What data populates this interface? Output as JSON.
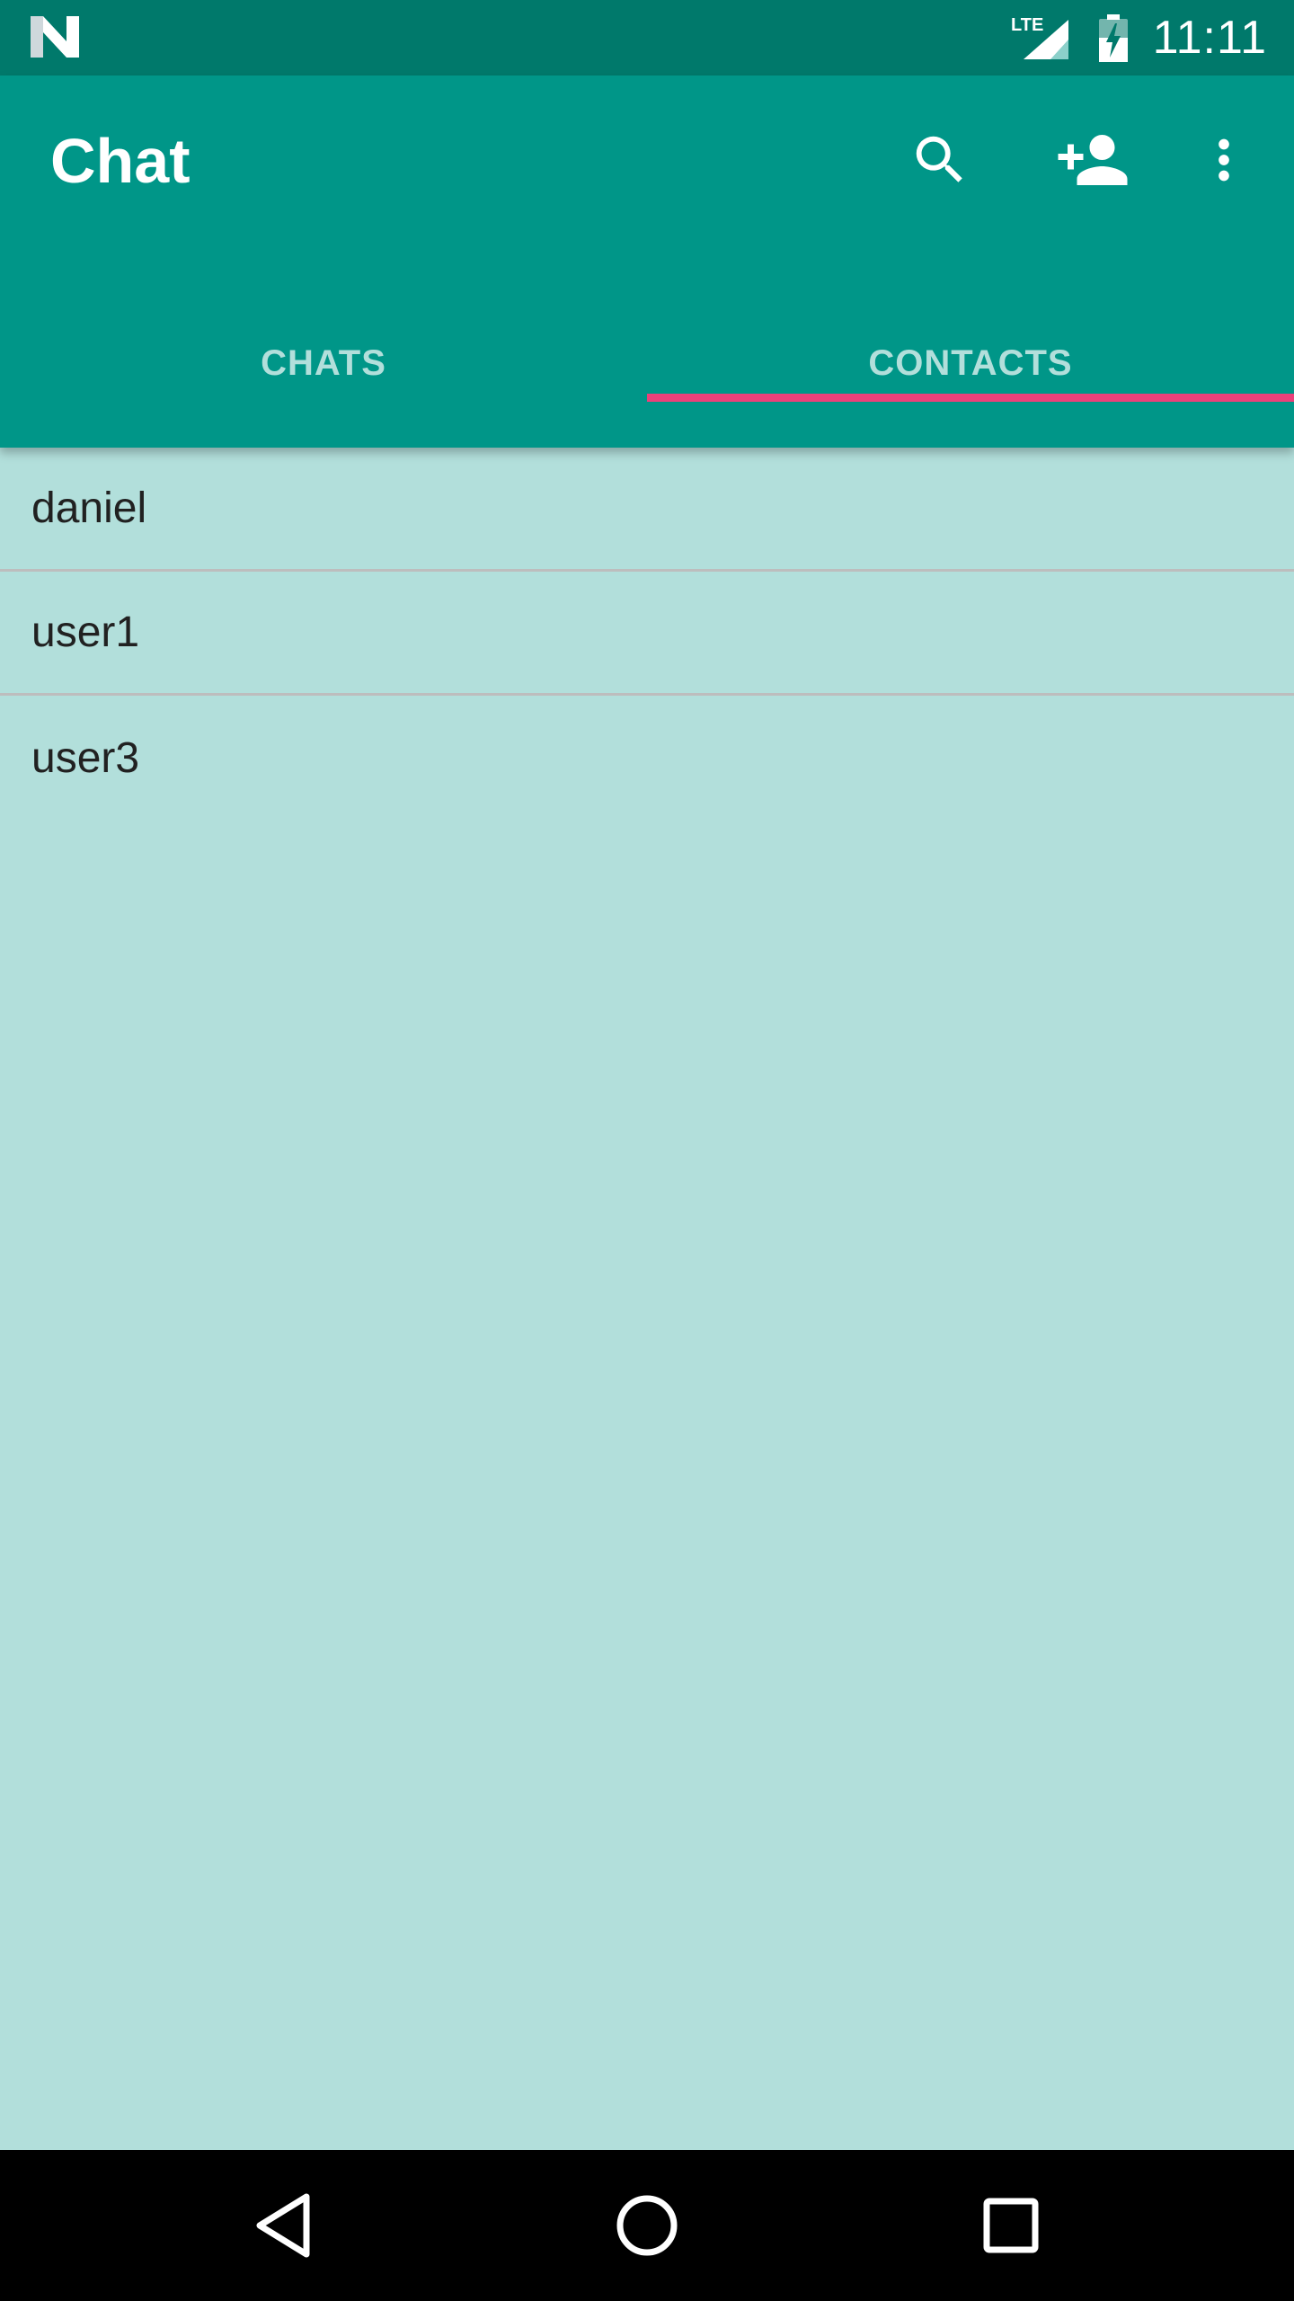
{
  "status_bar": {
    "network_label": "LTE",
    "time": "11:11"
  },
  "app_bar": {
    "title": "Chat",
    "icons": [
      "search-icon",
      "add-person-icon",
      "more-vert-icon"
    ],
    "accent_color": "#009688",
    "status_color": "#00796B"
  },
  "tabs": [
    {
      "label": "CHATS",
      "active": false
    },
    {
      "label": "CONTACTS",
      "active": true
    }
  ],
  "tab_indicator_color": "#EC407A",
  "contacts": [
    "daniel",
    "user1",
    "user3"
  ],
  "background_color": "#B2DFDB",
  "nav_bar": {
    "icons": [
      "back-icon",
      "home-icon",
      "recents-icon"
    ]
  }
}
